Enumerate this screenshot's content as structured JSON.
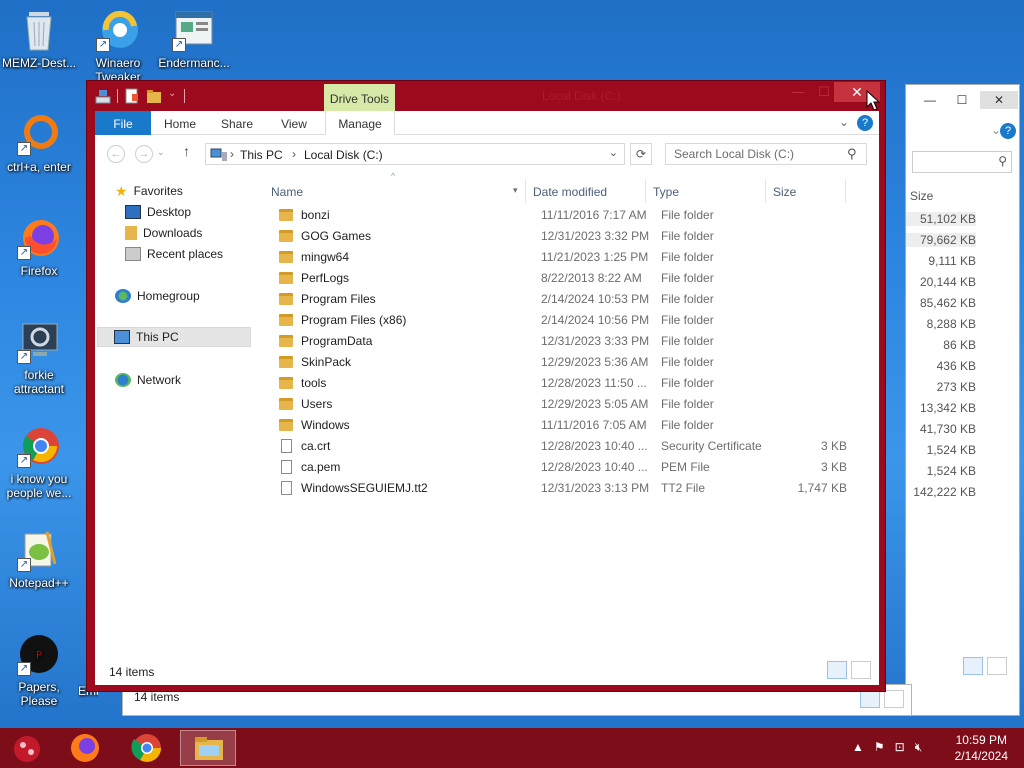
{
  "desktop": {
    "icons": [
      {
        "label": "MEMZ-Dest...",
        "icon": "recycle-bin-icon"
      },
      {
        "label": "Winaero Tweaker",
        "icon": "winaero-icon"
      },
      {
        "label": "Endermanc...",
        "icon": "endermanch-icon"
      },
      {
        "label": "ctrl+a, enter",
        "icon": "orange-ring-icon"
      },
      {
        "label": "Firefox",
        "icon": "firefox-icon"
      },
      {
        "label": "forkie attractant",
        "icon": "computer-gear-icon"
      },
      {
        "label": "i know you people we...",
        "icon": "chrome-icon"
      },
      {
        "label": "Notepad++",
        "icon": "notepadpp-icon"
      },
      {
        "label": "Papers, Please",
        "icon": "papers-please-icon"
      },
      {
        "label": "Emba Dev",
        "icon": "emba-icon"
      }
    ]
  },
  "background_window": {
    "col_size": "Size",
    "sizes": [
      "51,102 KB",
      "79,662 KB",
      "9,111 KB",
      "20,144 KB",
      "85,462 KB",
      "8,288 KB",
      "86 KB",
      "436 KB",
      "273 KB",
      "13,342 KB",
      "41,730 KB",
      "1,524 KB",
      "1,524 KB",
      "142,222 KB"
    ],
    "status": "14 items"
  },
  "window": {
    "title": "Local Disk (C:)",
    "context_tab": "Drive Tools",
    "close_glyph": "✕",
    "ribbon_tabs": [
      "File",
      "Home",
      "Share",
      "View",
      "Manage"
    ],
    "address": {
      "crumbs": [
        "This PC",
        "Local Disk (C:)"
      ]
    },
    "search_placeholder": "Search Local Disk (C:)",
    "nav": {
      "favorites": "Favorites",
      "desktop": "Desktop",
      "downloads": "Downloads",
      "recent": "Recent places",
      "homegroup": "Homegroup",
      "thispc": "This PC",
      "network": "Network"
    },
    "columns": {
      "name": "Name",
      "date": "Date modified",
      "type": "Type",
      "size": "Size"
    },
    "files": [
      {
        "name": "bonzi",
        "date": "11/11/2016 7:17 AM",
        "type": "File folder",
        "size": "",
        "kind": "folder"
      },
      {
        "name": "GOG Games",
        "date": "12/31/2023 3:32 PM",
        "type": "File folder",
        "size": "",
        "kind": "folder"
      },
      {
        "name": "mingw64",
        "date": "11/21/2023 1:25 PM",
        "type": "File folder",
        "size": "",
        "kind": "folder"
      },
      {
        "name": "PerfLogs",
        "date": "8/22/2013 8:22 AM",
        "type": "File folder",
        "size": "",
        "kind": "folder"
      },
      {
        "name": "Program Files",
        "date": "2/14/2024 10:53 PM",
        "type": "File folder",
        "size": "",
        "kind": "folder"
      },
      {
        "name": "Program Files (x86)",
        "date": "2/14/2024 10:56 PM",
        "type": "File folder",
        "size": "",
        "kind": "folder"
      },
      {
        "name": "ProgramData",
        "date": "12/31/2023 3:33 PM",
        "type": "File folder",
        "size": "",
        "kind": "folder"
      },
      {
        "name": "SkinPack",
        "date": "12/29/2023 5:36 AM",
        "type": "File folder",
        "size": "",
        "kind": "folder"
      },
      {
        "name": "tools",
        "date": "12/28/2023 11:50 ...",
        "type": "File folder",
        "size": "",
        "kind": "folder"
      },
      {
        "name": "Users",
        "date": "12/29/2023 5:05 AM",
        "type": "File folder",
        "size": "",
        "kind": "folder"
      },
      {
        "name": "Windows",
        "date": "11/11/2016 7:05 AM",
        "type": "File folder",
        "size": "",
        "kind": "folder"
      },
      {
        "name": "ca.crt",
        "date": "12/28/2023 10:40 ...",
        "type": "Security Certificate",
        "size": "3 KB",
        "kind": "file"
      },
      {
        "name": "ca.pem",
        "date": "12/28/2023 10:40 ...",
        "type": "PEM File",
        "size": "3 KB",
        "kind": "file"
      },
      {
        "name": "WindowsSEGUIEMJ.tt2",
        "date": "12/31/2023 3:13 PM",
        "type": "TT2 File",
        "size": "1,747 KB",
        "kind": "file"
      }
    ],
    "status": "14 items",
    "outer_status": "14 items"
  },
  "taskbar": {
    "time": "10:59 PM",
    "date": "2/14/2024"
  },
  "colors": {
    "frame": "#9c0a1d",
    "taskbar": "#7e0d1a",
    "accent": "#1979ca",
    "drive_tools": "#d7e9a6"
  }
}
